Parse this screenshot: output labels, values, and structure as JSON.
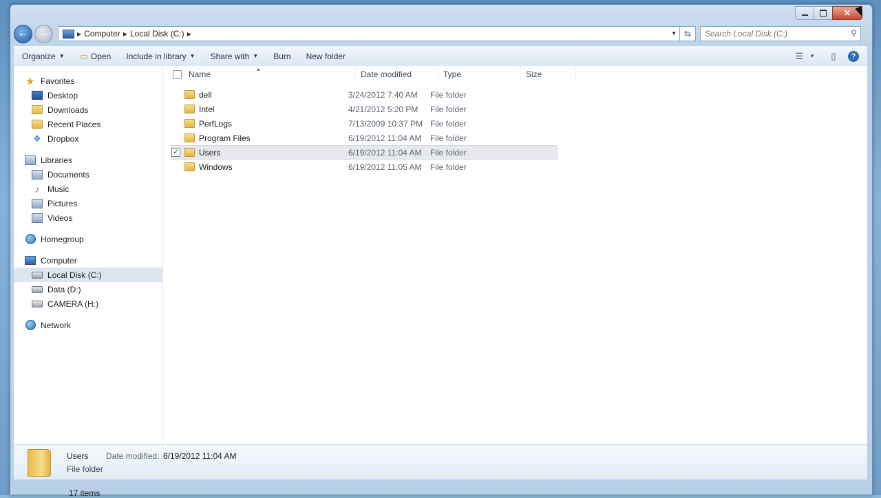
{
  "window": {
    "caption_icons": {
      "minimize": "minimize-icon",
      "maximize": "maximize-icon",
      "close": "close-icon"
    }
  },
  "address": {
    "crumbs": [
      "Computer",
      "Local Disk (C:)"
    ],
    "search_placeholder": "Search Local Disk (C:)"
  },
  "toolbar": {
    "organize": "Organize",
    "open": "Open",
    "include_in_library": "Include in library",
    "share_with": "Share with",
    "burn": "Burn",
    "new_folder": "New folder"
  },
  "sidebar": {
    "favorites": {
      "label": "Favorites",
      "items": [
        "Desktop",
        "Downloads",
        "Recent Places",
        "Dropbox"
      ]
    },
    "libraries": {
      "label": "Libraries",
      "items": [
        "Documents",
        "Music",
        "Pictures",
        "Videos"
      ]
    },
    "homegroup": {
      "label": "Homegroup"
    },
    "computer": {
      "label": "Computer",
      "items": [
        "Local Disk (C:)",
        "Data (D:)",
        "CAMERA (H:)"
      ],
      "selected": "Local Disk (C:)"
    },
    "network": {
      "label": "Network"
    }
  },
  "columns": {
    "name": "Name",
    "date": "Date modified",
    "type": "Type",
    "size": "Size"
  },
  "files": [
    {
      "name": "dell",
      "date": "3/24/2012 7:40 AM",
      "type": "File folder"
    },
    {
      "name": "Intel",
      "date": "4/21/2012 5:20 PM",
      "type": "File folder"
    },
    {
      "name": "PerfLogs",
      "date": "7/13/2009 10:37 PM",
      "type": "File folder"
    },
    {
      "name": "Program Files",
      "date": "6/19/2012 11:04 AM",
      "type": "File folder"
    },
    {
      "name": "Users",
      "date": "6/19/2012 11:04 AM",
      "type": "File folder",
      "selected": true
    },
    {
      "name": "Windows",
      "date": "6/19/2012 11:05 AM",
      "type": "File folder"
    }
  ],
  "details": {
    "name": "Users",
    "date_label": "Date modified:",
    "date_value": "6/19/2012 11:04 AM",
    "type": "File folder"
  },
  "status": {
    "items_text": "17 items"
  }
}
